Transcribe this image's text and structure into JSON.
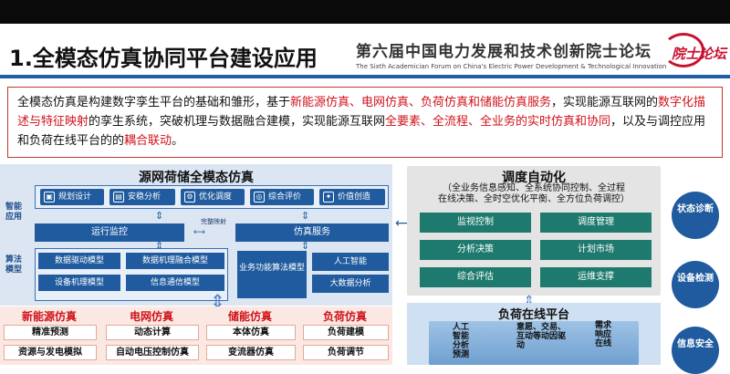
{
  "header": {
    "title": "1.全模态仿真协同平台建设应用",
    "forum_cn": "第六届中国电力发展和技术创新院士论坛",
    "forum_en": "The Sixth Academician Forum on China's Electric Power Development & Technological Innovation",
    "logo_text": "院士论坛"
  },
  "intro": {
    "p1": "全模态仿真是构建数字孪生平台的基础和雏形，基于",
    "p2": "新能源仿真、电网仿真、负荷仿真和储能仿真服务",
    "p3": "，实现能源互联网的",
    "p4": "数字化描述与特征映射",
    "p5": "的孪生系统，突破机理与数据融合建模，实现能源互联网",
    "p6": "全要素、全流程、全业务的实时仿真和协同",
    "p7": "，以及与调控应用和负荷在线平台的的",
    "p8": "耦合联动",
    "p9": "。"
  },
  "left": {
    "title": "源网荷储全模态仿真",
    "label_app": "智能应用",
    "label_algo": "算法模型",
    "apps": [
      "规划设计",
      "安稳分析",
      "优化调度",
      "综合评价",
      "价值创造"
    ],
    "app_icons": [
      "▣",
      "▤",
      "⚙",
      "◎",
      "✦"
    ],
    "run_monitor": "运行监控",
    "sim_service": "仿真服务",
    "mapping": "完整映射",
    "algo": [
      "数据驱动模型",
      "数据机理融合模型",
      "设备机理模型",
      "信息通信模型"
    ],
    "algo_big": "业务功能算法模型",
    "algo_right": [
      "人工智能",
      "大数据分析"
    ]
  },
  "sim": {
    "columns": [
      {
        "head": "新能源仿真",
        "cells": [
          "精准预测",
          "资源与发电模拟"
        ]
      },
      {
        "head": "电网仿真",
        "cells": [
          "动态计算",
          "自动电压控制仿真"
        ]
      },
      {
        "head": "储能仿真",
        "cells": [
          "本体仿真",
          "变流器仿真"
        ]
      },
      {
        "head": "负荷仿真",
        "cells": [
          "负荷建模",
          "负荷调节"
        ]
      }
    ]
  },
  "right": {
    "title": "调度自动化",
    "sub1": "（全业务信息感知、全系统协同控制、全过程",
    "sub2": "在线决策、全时空优化平衡、全方位负荷调控）",
    "items": [
      "监视控制",
      "调度管理",
      "分析决策",
      "计划市场",
      "综合评估",
      "运维支撑"
    ]
  },
  "load": {
    "title": "负荷在线平台",
    "t1": "人工智能分析预测",
    "t2": "意愿、交易、互动等动因驱动",
    "t3": "需求响应在线"
  },
  "circles": [
    "状态诊断",
    "设备检测",
    "信息安全"
  ]
}
